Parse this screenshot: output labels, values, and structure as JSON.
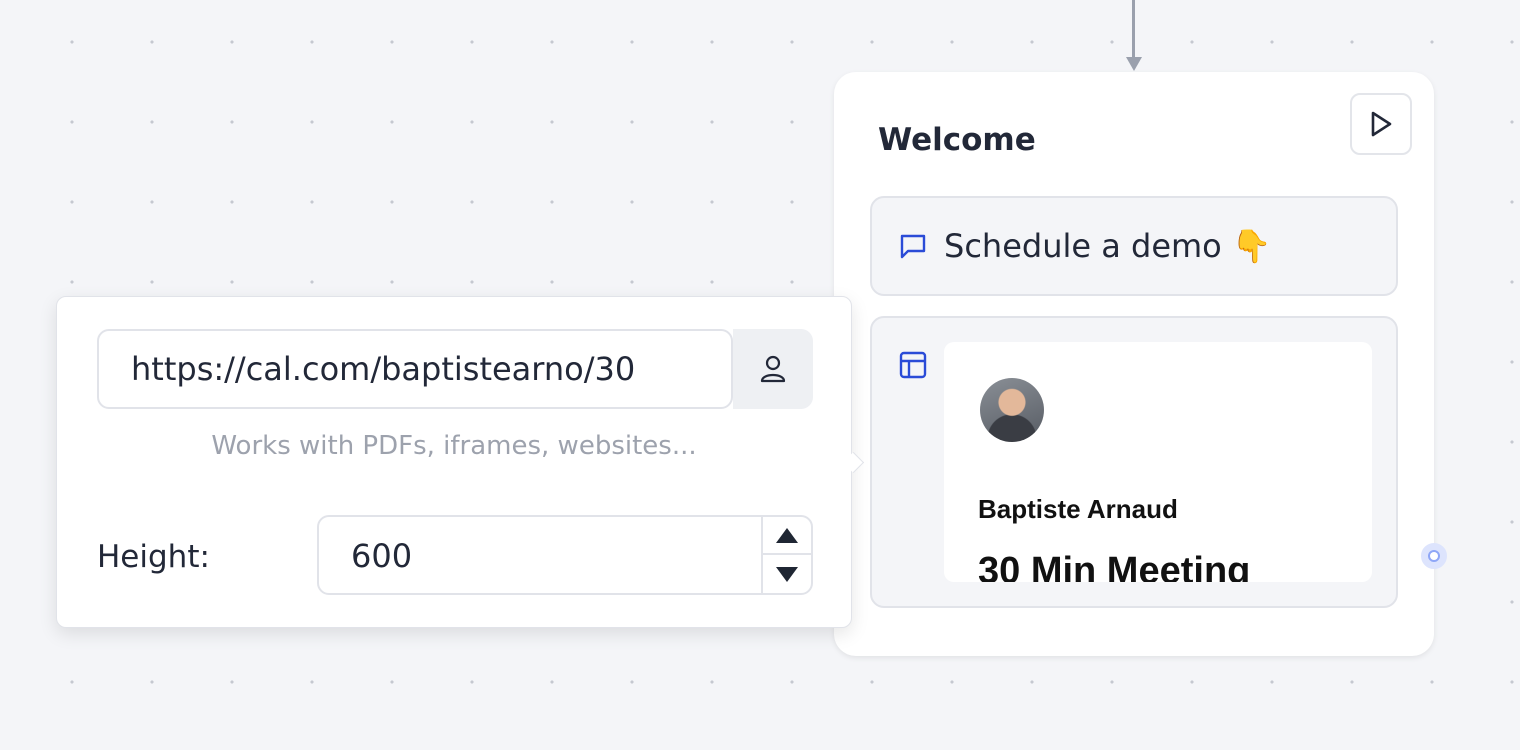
{
  "group": {
    "title": "Welcome",
    "text_block": {
      "label": "Schedule a demo 👇",
      "icon": "chat-bubble-icon"
    },
    "embed_block": {
      "icon": "layout-icon",
      "preview": {
        "host_name": "Baptiste Arnaud",
        "meeting_title": "30 Min Meeting"
      }
    }
  },
  "embed_settings": {
    "url_value": "https://cal.com/baptistearno/30",
    "hint": "Works with PDFs, iframes, websites...",
    "height_label": "Height:",
    "height_value": "600"
  },
  "colors": {
    "accent": "#2a4bd7",
    "anchor": "#8fa7f7",
    "connector": "#9aa0ad"
  }
}
